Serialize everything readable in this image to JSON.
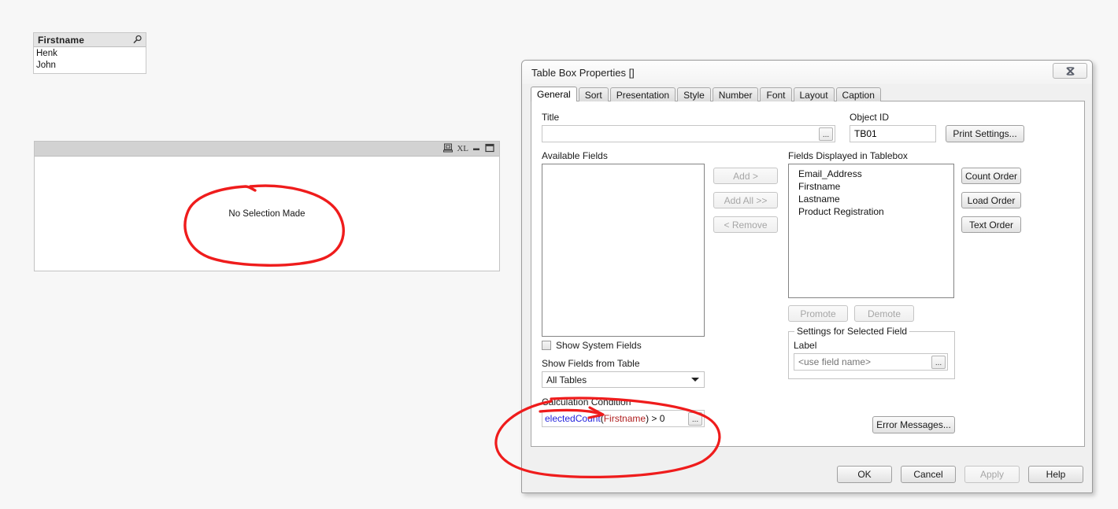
{
  "listbox": {
    "title": "Firstname",
    "search_icon": "magnifier-icon",
    "rows": [
      "Henk",
      "John"
    ]
  },
  "tablebox": {
    "caption_icons": [
      "print-icon",
      "xl-export-label",
      "minimize-icon",
      "maximize-icon"
    ],
    "xl_label": "XL",
    "body_text": "No Selection Made"
  },
  "dialog": {
    "title": "Table Box Properties []",
    "close_icon": "close-icon",
    "tabs": [
      {
        "label": "General",
        "active": true
      },
      {
        "label": "Sort",
        "active": false
      },
      {
        "label": "Presentation",
        "active": false
      },
      {
        "label": "Style",
        "active": false
      },
      {
        "label": "Number",
        "active": false
      },
      {
        "label": "Font",
        "active": false
      },
      {
        "label": "Layout",
        "active": false
      },
      {
        "label": "Caption",
        "active": false
      }
    ],
    "general": {
      "title_label": "Title",
      "title_value": "",
      "title_placeholder": "",
      "title_browse_label": "...",
      "object_id_label": "Object ID",
      "object_id_value": "TB01",
      "print_settings_label": "Print Settings...",
      "available_fields_label": "Available Fields",
      "available_fields": [],
      "add_label": "Add >",
      "add_all_label": "Add All >>",
      "remove_label": "< Remove",
      "displayed_label": "Fields Displayed in Tablebox",
      "displayed_fields": [
        "Email_Address",
        "Firstname",
        "Lastname",
        "Product Registration"
      ],
      "count_order_label": "Count Order",
      "load_order_label": "Load Order",
      "text_order_label": "Text Order",
      "promote_label": "Promote",
      "demote_label": "Demote",
      "settings_group_label": "Settings for Selected Field",
      "label_label": "Label",
      "label_value": "",
      "label_placeholder": "<use field name>",
      "label_browse_label": "...",
      "show_system_fields_label": "Show System Fields",
      "show_system_fields_checked": false,
      "show_fields_from_table_label": "Show Fields from Table",
      "table_selected": "All Tables",
      "calc_condition_label": "Calculation Condition",
      "calc_condition_tokens": [
        {
          "text": "electedCount",
          "kind": "fn"
        },
        {
          "text": "(",
          "kind": "op"
        },
        {
          "text": "Firstname",
          "kind": "fld"
        },
        {
          "text": ")",
          "kind": "op"
        },
        {
          "text": " > 0",
          "kind": "op"
        }
      ],
      "calc_browse_label": "...",
      "error_messages_label": "Error Messages..."
    },
    "footer": {
      "ok_label": "OK",
      "cancel_label": "Cancel",
      "apply_label": "Apply",
      "apply_disabled": true,
      "help_label": "Help"
    }
  },
  "annotations": {
    "color": "#ef1c1c",
    "marks": [
      {
        "name": "ellipse-no-selection-made"
      },
      {
        "name": "ellipse-calculation-condition"
      },
      {
        "name": "arrow-to-calculation-condition"
      }
    ]
  }
}
